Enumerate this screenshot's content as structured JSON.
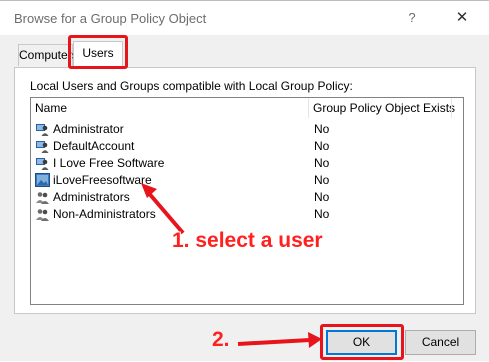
{
  "window": {
    "title": "Browse for a Group Policy Object",
    "help_glyph": "?",
    "close_glyph": "✕"
  },
  "tabs": [
    {
      "label": "Computers",
      "selected": false
    },
    {
      "label": "Users",
      "selected": true
    }
  ],
  "panel": {
    "description": "Local Users and Groups compatible with Local Group Policy:"
  },
  "list": {
    "columns": [
      "Name",
      "Group Policy Object Exists"
    ],
    "rows": [
      {
        "name": "Administrator",
        "exists": "No",
        "icon": "user-icon"
      },
      {
        "name": "DefaultAccount",
        "exists": "No",
        "icon": "user-icon"
      },
      {
        "name": "I Love Free Software",
        "exists": "No",
        "icon": "user-icon"
      },
      {
        "name": "iLoveFreesoftware",
        "exists": "No",
        "icon": "user-picture-icon"
      },
      {
        "name": "Administrators",
        "exists": "No",
        "icon": "group-icon"
      },
      {
        "name": "Non-Administrators",
        "exists": "No",
        "icon": "group-icon"
      }
    ]
  },
  "annotations": {
    "step1": "1. select a user",
    "step2": "2.",
    "color": "#e8141b"
  },
  "buttons": {
    "ok": "OK",
    "cancel": "Cancel"
  }
}
